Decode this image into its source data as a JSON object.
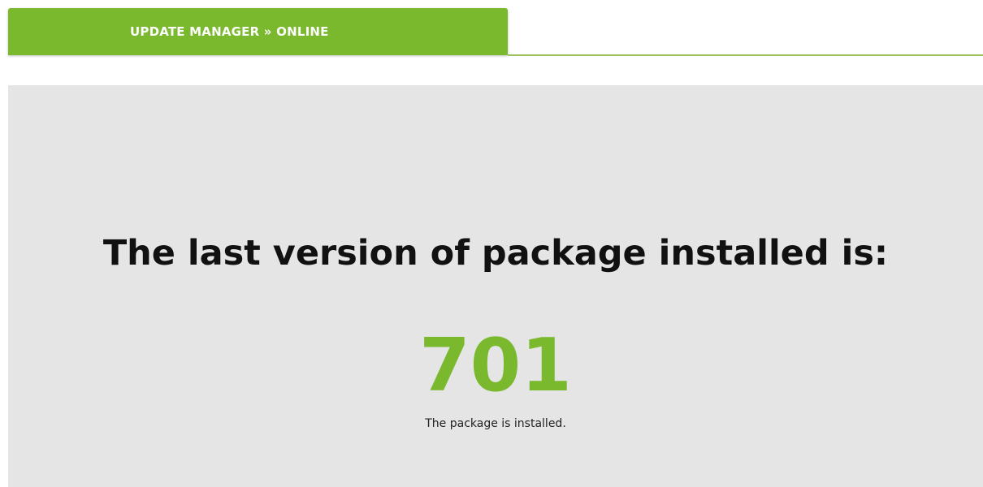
{
  "header": {
    "tab_label": "UPDATE MANAGER » ONLINE"
  },
  "main": {
    "headline": "The last version of package installed is:",
    "version_number": "701",
    "status_text": "The package is installed."
  },
  "colors": {
    "accent": "#7ab82e",
    "panel_background": "#e5e5e5",
    "headline_text": "#111111"
  }
}
